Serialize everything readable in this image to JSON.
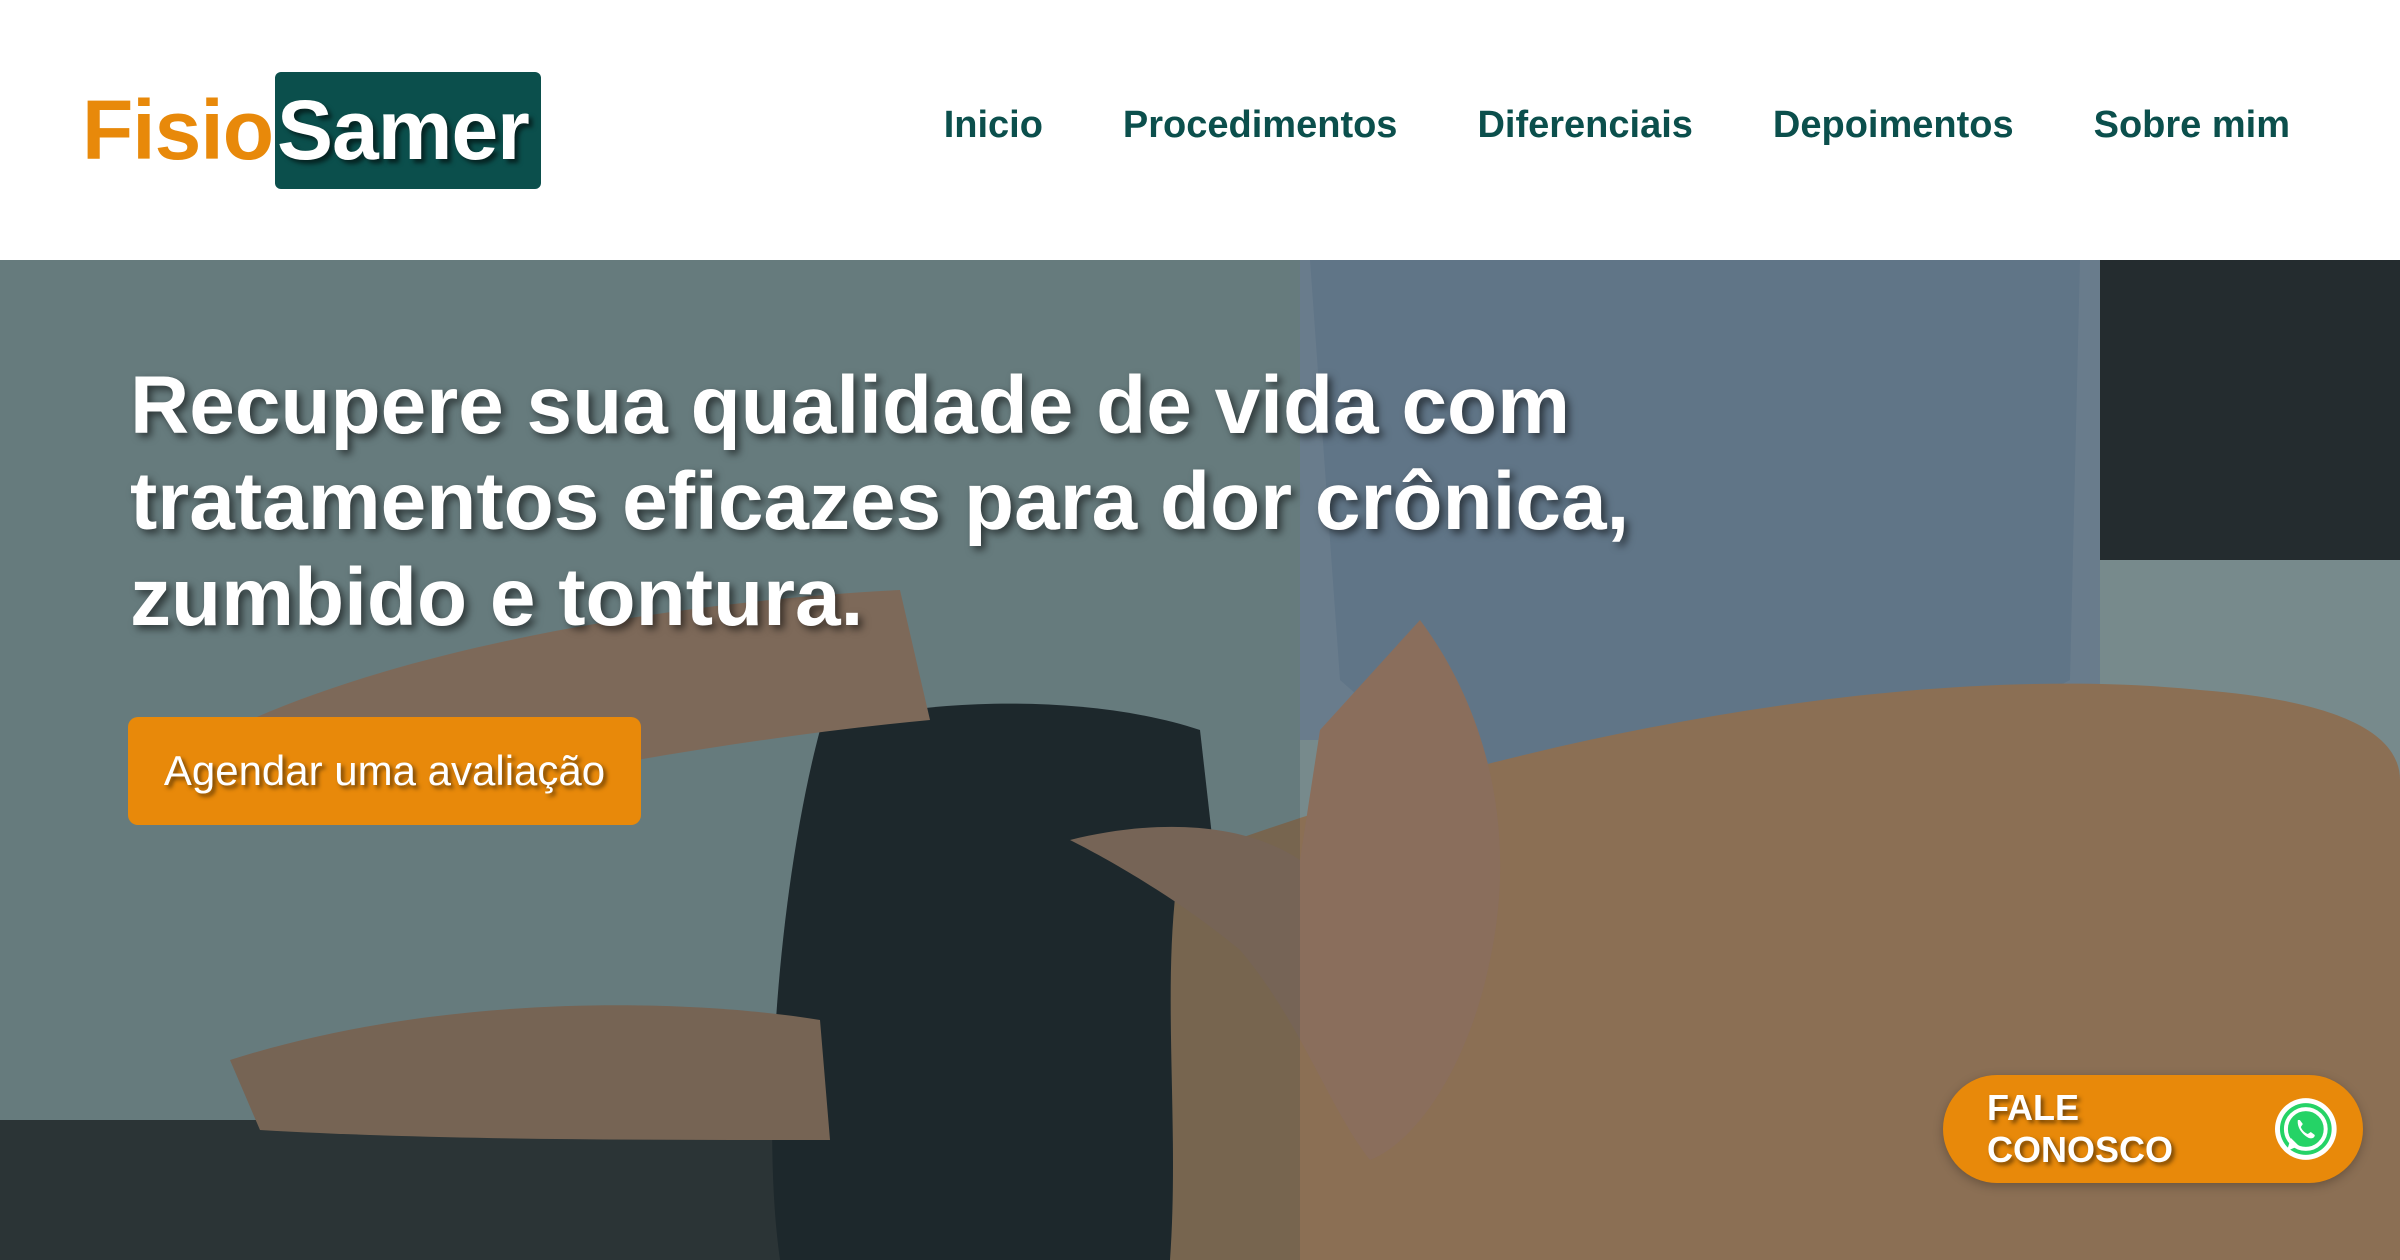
{
  "logo": {
    "part1": "Fisio",
    "part2": "Samer"
  },
  "nav": {
    "items": [
      {
        "label": "Inicio"
      },
      {
        "label": "Procedimentos"
      },
      {
        "label": "Diferenciais"
      },
      {
        "label": "Depoimentos"
      },
      {
        "label": "Sobre mim"
      }
    ]
  },
  "hero": {
    "headline": "Recupere sua qualidade de vida com tratamentos eficazes para dor crônica, zumbido e tontura.",
    "cta_label": "Agendar uma avaliação"
  },
  "floating_contact": {
    "label": "FALE CONOSCO",
    "icon": "whatsapp-icon"
  },
  "colors": {
    "brand_orange": "#e8890a",
    "brand_teal": "#0b4f4c"
  }
}
